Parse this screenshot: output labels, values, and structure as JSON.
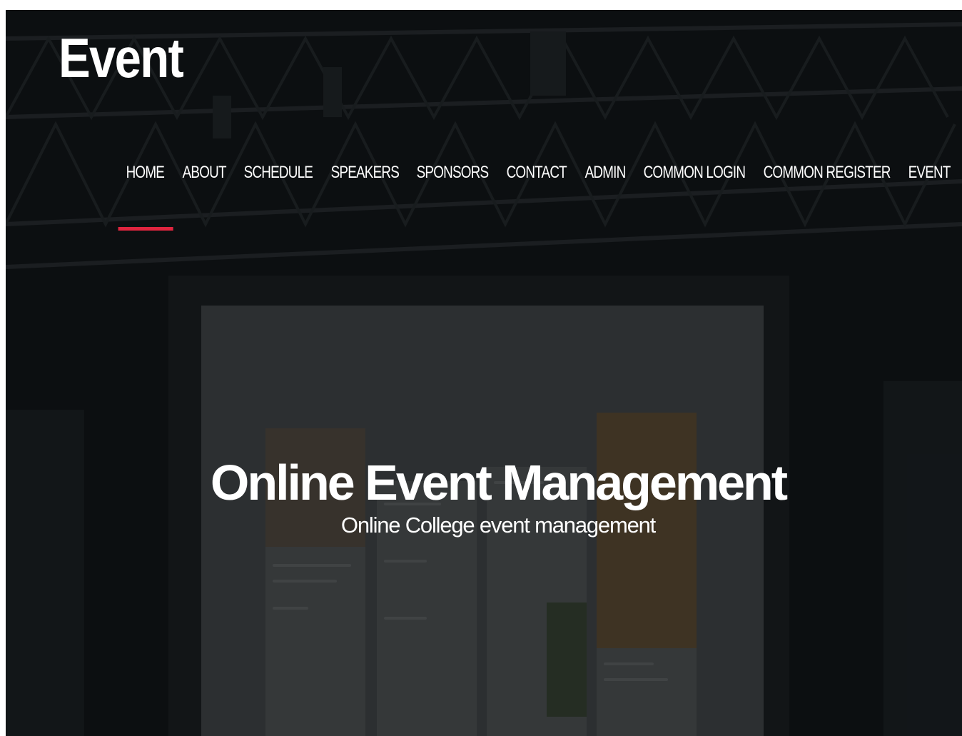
{
  "brand": {
    "logo_text": "Event"
  },
  "nav": {
    "items": [
      {
        "label": "HOME",
        "active": true
      },
      {
        "label": "ABOUT",
        "active": false
      },
      {
        "label": "SCHEDULE",
        "active": false
      },
      {
        "label": "SPEAKERS",
        "active": false
      },
      {
        "label": "SPONSORS",
        "active": false
      },
      {
        "label": "CONTACT",
        "active": false
      },
      {
        "label": "ADMIN",
        "active": false
      },
      {
        "label": "COMMON LOGIN",
        "active": false
      },
      {
        "label": "COMMON REGISTER",
        "active": false
      },
      {
        "label": "EVENT",
        "active": false
      }
    ]
  },
  "hero": {
    "title": "Online Event Management",
    "subtitle": "Online College event management"
  },
  "colors": {
    "accent": "#e0253f",
    "text": "#ffffff",
    "background": "#101316"
  }
}
